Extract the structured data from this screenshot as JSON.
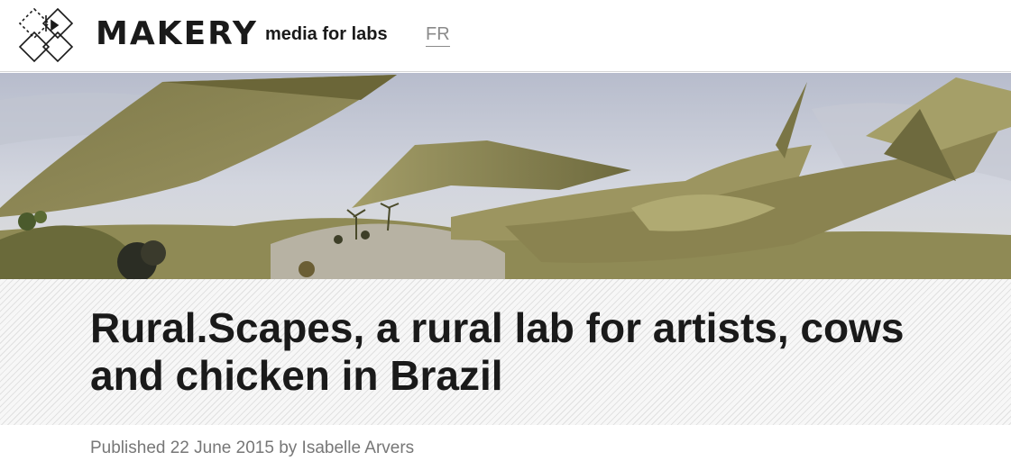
{
  "header": {
    "brand": "MAKERY",
    "tagline": "media for labs",
    "language_link": "FR"
  },
  "hero": {
    "image_icon": "hero-landscape-image"
  },
  "article": {
    "title": "Rural.Scapes, a rural lab for artists, cows and chicken in Brazil",
    "published_label": "Published",
    "date": "22 June 2015",
    "by_label": "by",
    "author": "Isabelle Arvers"
  },
  "colors": {
    "text_dark": "#1a1a1a",
    "text_muted": "#777777",
    "link_gray": "#8a8a8a",
    "shape_olive": "#8c8550",
    "sky": "#c5c9d6"
  }
}
